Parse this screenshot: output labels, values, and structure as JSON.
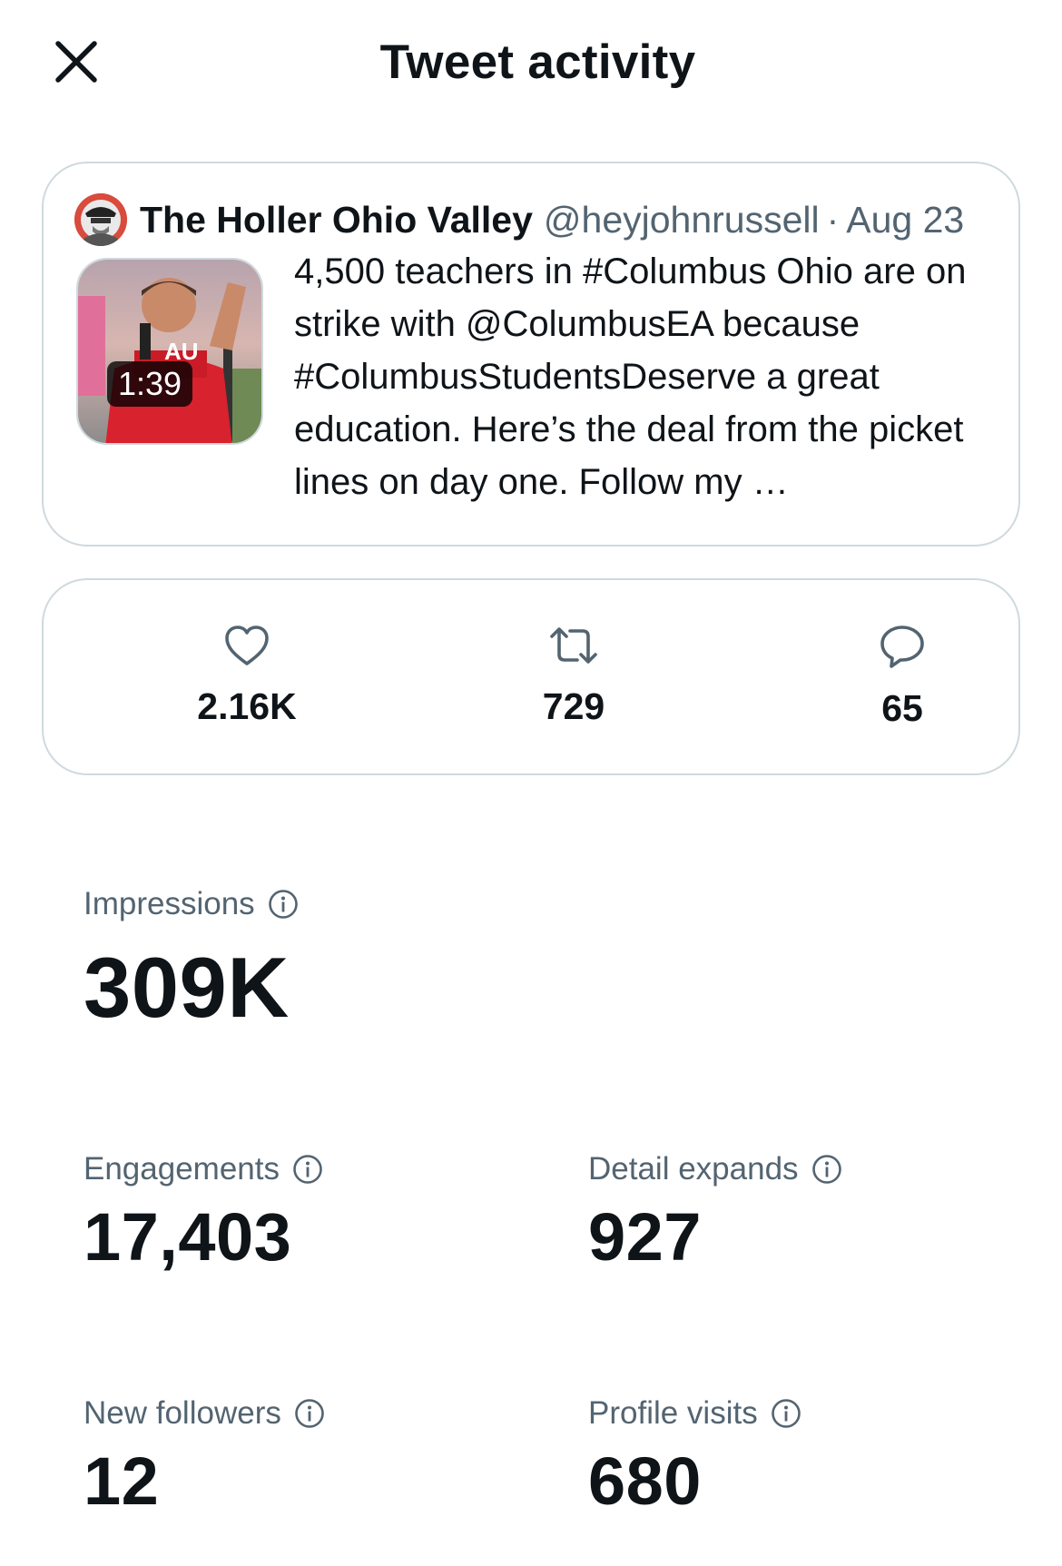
{
  "header": {
    "title": "Tweet activity",
    "close_icon": "close-icon"
  },
  "tweet": {
    "author_name": "The Holler Ohio Valley",
    "handle": "@heyjohnrussell",
    "separator": "·",
    "date": "Aug 23",
    "video_duration": "1:39",
    "text": "4,500 teachers in #Columbus Ohio are on strike with @ColumbusEA because #ColumbusStudentsDeserve a great education. Here’s the deal from the picket lines on day one. Follow my …"
  },
  "counts": {
    "likes": {
      "icon": "heart-icon",
      "value": "2.16K"
    },
    "retweets": {
      "icon": "retweet-icon",
      "value": "729"
    },
    "replies": {
      "icon": "reply-icon",
      "value": "65"
    }
  },
  "stats": {
    "impressions": {
      "label": "Impressions",
      "value": "309K"
    },
    "engagements": {
      "label": "Engagements",
      "value": "17,403"
    },
    "detail_expands": {
      "label": "Detail expands",
      "value": "927"
    },
    "new_followers": {
      "label": "New followers",
      "value": "12"
    },
    "profile_visits": {
      "label": "Profile visits",
      "value": "680"
    }
  },
  "colors": {
    "text": "#0f1419",
    "secondary": "#536471",
    "border": "#cfd9de"
  }
}
